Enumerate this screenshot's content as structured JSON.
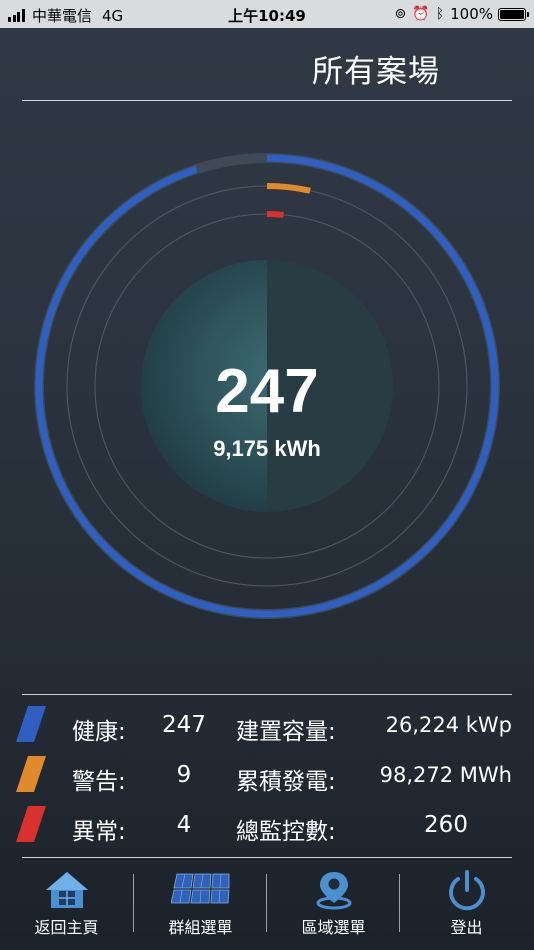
{
  "status_bar": {
    "carrier": "中華電信",
    "network": "4G",
    "time": "上午10:49",
    "battery": "100%",
    "battery_level": 1.0
  },
  "header": {
    "title": "所有案場"
  },
  "gauge": {
    "count": "247",
    "energy": "9,175 kWh",
    "rings": [
      {
        "name": "healthy",
        "color": "#2f5fc0",
        "value": 247,
        "total": 260
      },
      {
        "name": "warning",
        "color": "#e08a2c",
        "value": 9,
        "total": 260
      },
      {
        "name": "abnormal",
        "color": "#d9322e",
        "value": 4,
        "total": 260
      }
    ]
  },
  "stats": [
    {
      "color": "#2f5fc0",
      "label": "健康:",
      "value": "247",
      "label2": "建置容量:",
      "value2": "26,224 kWp"
    },
    {
      "color": "#e08a2c",
      "label": "警告:",
      "value": "9",
      "label2": "累積發電:",
      "value2": "98,272 MWh"
    },
    {
      "color": "#d9322e",
      "label": "異常:",
      "value": "4",
      "label2": "總監控數:",
      "value2": "260"
    }
  ],
  "tabs": [
    {
      "label": "返回主頁",
      "icon": "home-icon"
    },
    {
      "label": "群組選單",
      "icon": "solar-panels-icon"
    },
    {
      "label": "區域選單",
      "icon": "location-pin-icon"
    },
    {
      "label": "登出",
      "icon": "power-icon"
    }
  ]
}
